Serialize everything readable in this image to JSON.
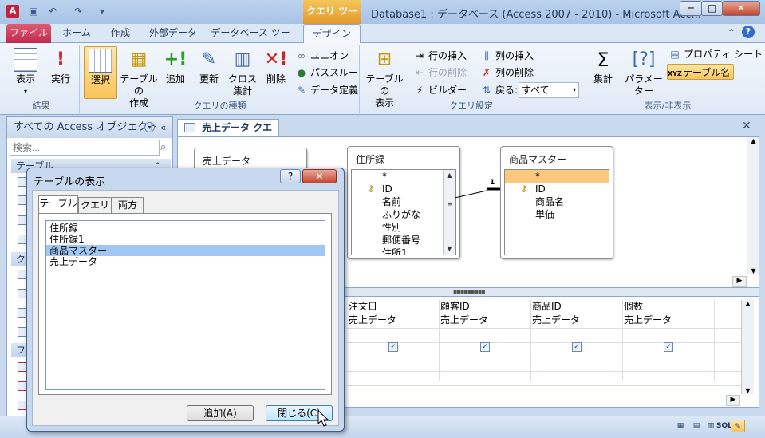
{
  "window": {
    "title": "Database1 : データベース (Access 2007 - 2010)  -  Microsoft Acc...",
    "context_tab": "クエリ ツール",
    "minimize": "─",
    "maximize": "□",
    "close": "✕"
  },
  "quick_access": {
    "save_icon": "save-icon",
    "undo_icon": "undo-icon",
    "redo_icon": "redo-icon"
  },
  "tabs": [
    "ファイル",
    "ホーム",
    "作成",
    "外部データ",
    "データベース ツール",
    "デザイン"
  ],
  "ribbon": {
    "results": {
      "label": "結果",
      "view": "表示",
      "run": "実行"
    },
    "query_type": {
      "label": "クエリの種類",
      "select": "選択",
      "make_table_1": "テーブルの",
      "make_table_2": "作成",
      "append": "追加",
      "update": "更新",
      "crosstab_1": "クロス",
      "crosstab_2": "集計",
      "delete": "削除",
      "union": "ユニオン",
      "passthrough": "パススルー",
      "data_definition": "データ定義"
    },
    "query_setup": {
      "label": "クエリ設定",
      "show_table_1": "テーブルの",
      "show_table_2": "表示",
      "insert_rows": "行の挿入",
      "delete_rows": "行の削除",
      "builder": "ビルダー",
      "insert_columns": "列の挿入",
      "delete_columns": "列の削除",
      "return_label": "戻る:",
      "return_value": "すべて"
    },
    "show_hide": {
      "label": "表示/非表示",
      "totals": "集計",
      "parameters": "パラメーター",
      "property_sheet": "プロパティ シート",
      "table_names": "テーブル名"
    }
  },
  "nav": {
    "header": "すべての Access オブジェクト",
    "search_placeholder": "検索...",
    "categories": [
      "テーブル",
      "クエリ",
      "フォーム"
    ]
  },
  "document": {
    "tab_title": "売上データ クエリ"
  },
  "tables": {
    "sales": {
      "title": "売上データ"
    },
    "address": {
      "title": "住所録",
      "fields": [
        "*",
        "ID",
        "名前",
        "ふりがな",
        "性別",
        "郵便番号",
        "住所1"
      ]
    },
    "product": {
      "title": "商品マスター",
      "fields": [
        "*",
        "ID",
        "商品名",
        "単価"
      ]
    },
    "join_one": "1"
  },
  "grid": {
    "columns": [
      {
        "field": "注文日",
        "table": "売上データ",
        "show": true
      },
      {
        "field": "顧客ID",
        "table": "売上データ",
        "show": true
      },
      {
        "field": "商品ID",
        "table": "売上データ",
        "show": true
      },
      {
        "field": "個数",
        "table": "売上データ",
        "show": true
      }
    ]
  },
  "dialog": {
    "title": "テーブルの表示",
    "help": "?",
    "close": "✕",
    "tabs": [
      "テーブル",
      "クエリ",
      "両方"
    ],
    "items": [
      "住所録",
      "住所録1",
      "商品マスター",
      "売上データ"
    ],
    "selected_index": 2,
    "add_button": "追加(A)",
    "close_button": "閉じる(C)"
  },
  "status_bar": {
    "sql": "SQL"
  }
}
